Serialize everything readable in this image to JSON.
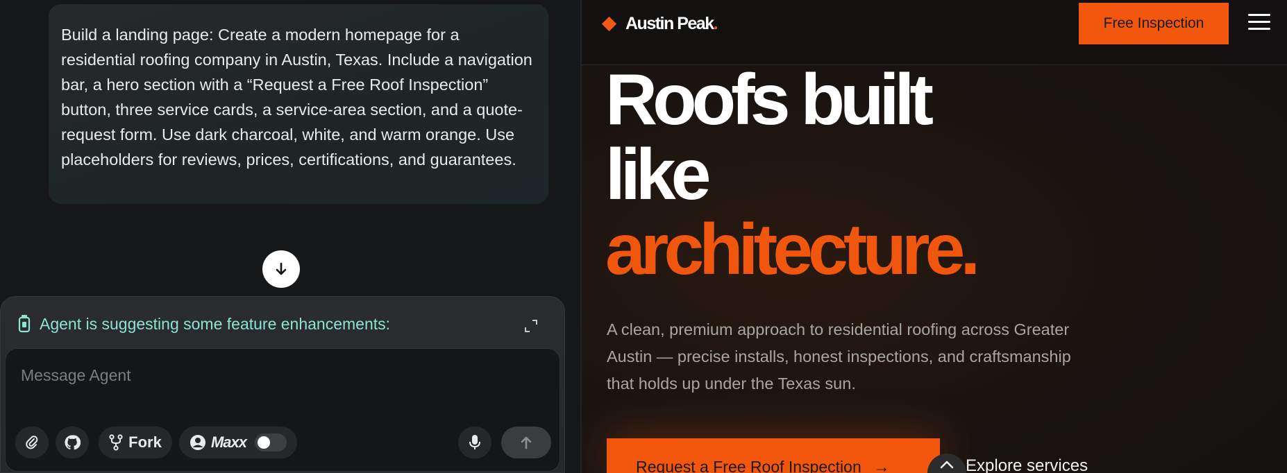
{
  "chat": {
    "user_message": "Build a landing page: Create a modern homepage for a residential roofing company in Austin, Texas. Include a navigation bar, a hero section with a “Request a Free Roof Inspection” button, three service cards, a service-area section, and a quote-request form. Use dark charcoal, white, and warm orange. Use placeholders for reviews, prices, certifications, and guarantees.",
    "scroll_down_icon": "arrow-down-icon"
  },
  "composer": {
    "suggestion_text": "Agent is suggesting some feature enhancements:",
    "suggestion_icon": "agent-bulb-icon",
    "input_placeholder": "Message Agent",
    "tools": {
      "attach_icon": "paperclip-icon",
      "github_icon": "github-icon",
      "fork_label": "Fork",
      "maxx_label": "Maxx",
      "maxx_enabled": false,
      "mic_icon": "microphone-icon",
      "send_icon": "arrow-up-icon"
    }
  },
  "preview": {
    "nav": {
      "brand": "Austin Peak",
      "brand_dot": ".",
      "cta_label": "Free Inspection",
      "menu_icon": "hamburger-icon"
    },
    "hero": {
      "line1": "Roofs built",
      "line2": "like",
      "line3": "architecture.",
      "subtitle": "A clean, premium approach to residential roofing across Greater Austin — precise installs, honest inspections, and craftsmanship that holds up under the Texas sun.",
      "primary_cta": "Request a Free Roof Inspection",
      "primary_cta_arrow": "→",
      "secondary_cta": "Explore services"
    },
    "colors": {
      "accent": "#f2570d",
      "background": "#141212",
      "text": "#ffffff"
    }
  }
}
